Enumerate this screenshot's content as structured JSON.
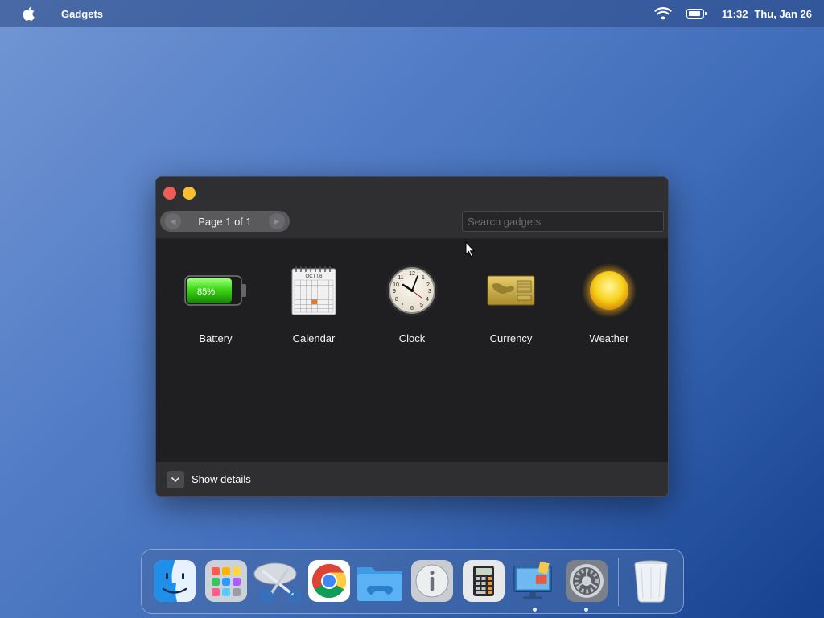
{
  "menubar": {
    "app_name": "Gadgets",
    "time": "11:32",
    "date": "Thu, Jan 26",
    "icons": [
      "apple-icon",
      "wifi-icon",
      "battery-icon"
    ]
  },
  "window": {
    "pager": {
      "label": "Page 1 of 1"
    },
    "search": {
      "placeholder": "Search gadgets",
      "value": ""
    },
    "gadgets": [
      {
        "label": "Battery",
        "icon": "battery-gadget-icon",
        "value_text": "85%"
      },
      {
        "label": "Calendar",
        "icon": "calendar-gadget-icon",
        "month": "OCT 06"
      },
      {
        "label": "Clock",
        "icon": "clock-gadget-icon"
      },
      {
        "label": "Currency",
        "icon": "currency-gadget-icon"
      },
      {
        "label": "Weather",
        "icon": "weather-gadget-icon"
      }
    ],
    "footer": {
      "details_label": "Show details"
    }
  },
  "dock": {
    "items": [
      {
        "name": "finder",
        "icon": "finder-icon",
        "running": false
      },
      {
        "name": "launchpad",
        "icon": "launchpad-icon",
        "running": false
      },
      {
        "name": "snipping-tool",
        "icon": "scissors-icon",
        "running": false
      },
      {
        "name": "chrome",
        "icon": "chrome-icon",
        "running": false
      },
      {
        "name": "files",
        "icon": "folder-gamepad-icon",
        "running": false
      },
      {
        "name": "info",
        "icon": "info-icon",
        "running": false
      },
      {
        "name": "calculator",
        "icon": "calculator-icon",
        "running": false
      },
      {
        "name": "gadgets",
        "icon": "gadgets-monitor-icon",
        "running": true
      },
      {
        "name": "system-preferences",
        "icon": "settings-gear-icon",
        "running": true
      },
      {
        "name": "trash",
        "icon": "trash-icon",
        "running": false
      }
    ]
  },
  "colors": {
    "close": "#f25c57",
    "minimize": "#f8be2f",
    "window_bg": "#1f1f21",
    "titlebar_bg": "#2f2f31"
  }
}
